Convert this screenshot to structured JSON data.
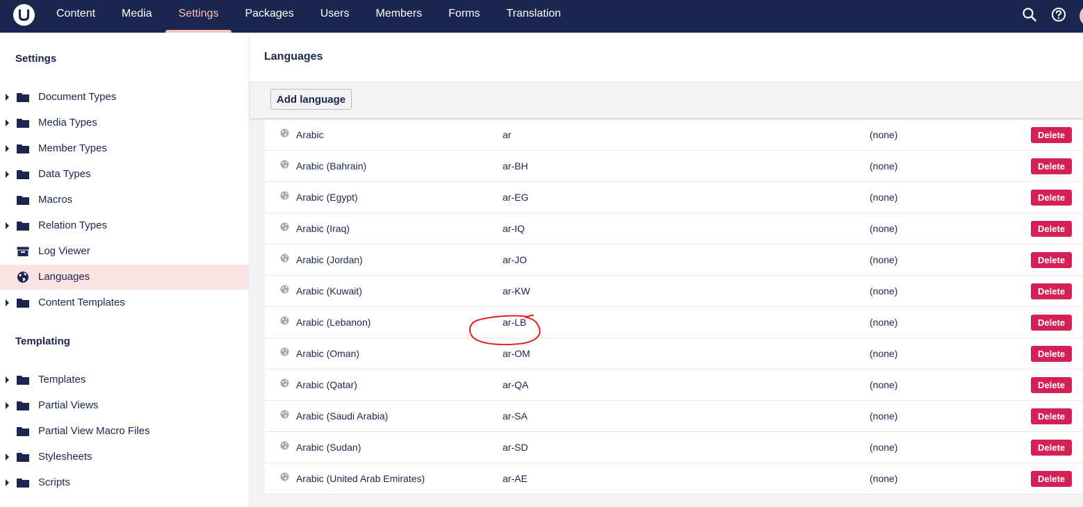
{
  "topnav": {
    "items": [
      {
        "label": "Content"
      },
      {
        "label": "Media"
      },
      {
        "label": "Settings",
        "active": true
      },
      {
        "label": "Packages"
      },
      {
        "label": "Users"
      },
      {
        "label": "Members"
      },
      {
        "label": "Forms"
      },
      {
        "label": "Translation"
      }
    ],
    "icons": [
      "search-icon",
      "help-icon"
    ]
  },
  "sidebar": {
    "settings_heading": "Settings",
    "settings_items": [
      {
        "label": "Document Types",
        "icon": "folder-icon",
        "expandable": true
      },
      {
        "label": "Media Types",
        "icon": "folder-icon",
        "expandable": true
      },
      {
        "label": "Member Types",
        "icon": "folder-icon",
        "expandable": true
      },
      {
        "label": "Data Types",
        "icon": "folder-icon",
        "expandable": true
      },
      {
        "label": "Macros",
        "icon": "folder-icon",
        "expandable": false
      },
      {
        "label": "Relation Types",
        "icon": "folder-icon",
        "expandable": true
      },
      {
        "label": "Log Viewer",
        "icon": "archive-icon",
        "expandable": false
      },
      {
        "label": "Languages",
        "icon": "globe-icon",
        "expandable": false,
        "selected": true
      },
      {
        "label": "Content Templates",
        "icon": "folder-icon",
        "expandable": true
      }
    ],
    "templating_heading": "Templating",
    "templating_items": [
      {
        "label": "Templates",
        "icon": "folder-icon",
        "expandable": true
      },
      {
        "label": "Partial Views",
        "icon": "folder-icon",
        "expandable": true
      },
      {
        "label": "Partial View Macro Files",
        "icon": "folder-icon",
        "expandable": false
      },
      {
        "label": "Stylesheets",
        "icon": "folder-icon",
        "expandable": true
      },
      {
        "label": "Scripts",
        "icon": "folder-icon",
        "expandable": true
      }
    ]
  },
  "main": {
    "title": "Languages",
    "add_button_label": "Add language",
    "delete_label": "Delete",
    "rows": [
      {
        "name": "Arabic",
        "iso": "ar",
        "fallback": "(none)"
      },
      {
        "name": "Arabic (Bahrain)",
        "iso": "ar-BH",
        "fallback": "(none)"
      },
      {
        "name": "Arabic (Egypt)",
        "iso": "ar-EG",
        "fallback": "(none)"
      },
      {
        "name": "Arabic (Iraq)",
        "iso": "ar-IQ",
        "fallback": "(none)"
      },
      {
        "name": "Arabic (Jordan)",
        "iso": "ar-JO",
        "fallback": "(none)"
      },
      {
        "name": "Arabic (Kuwait)",
        "iso": "ar-KW",
        "fallback": "(none)"
      },
      {
        "name": "Arabic (Lebanon)",
        "iso": "ar-LB",
        "fallback": "(none)"
      },
      {
        "name": "Arabic (Oman)",
        "iso": "ar-OM",
        "fallback": "(none)"
      },
      {
        "name": "Arabic (Qatar)",
        "iso": "ar-QA",
        "fallback": "(none)"
      },
      {
        "name": "Arabic (Saudi Arabia)",
        "iso": "ar-SA",
        "fallback": "(none)"
      },
      {
        "name": "Arabic (Sudan)",
        "iso": "ar-SD",
        "fallback": "(none)"
      },
      {
        "name": "Arabic (United Arab Emirates)",
        "iso": "ar-AE",
        "fallback": "(none)"
      }
    ]
  },
  "colors": {
    "navbar": "#1b264f",
    "nav_active": "#f5c1bc",
    "selected_item_bg": "#fbe5e4",
    "delete_button": "#d42054",
    "annotation": "#e8201f"
  }
}
